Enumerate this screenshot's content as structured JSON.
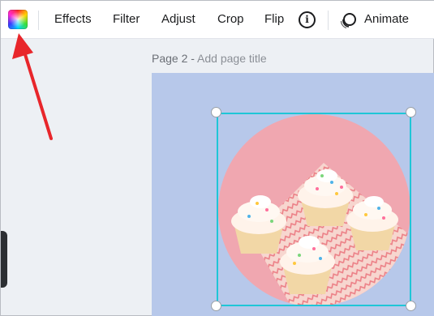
{
  "toolbar": {
    "effects_label": "Effects",
    "filter_label": "Filter",
    "adjust_label": "Adjust",
    "crop_label": "Crop",
    "flip_label": "Flip",
    "info_glyph": "i",
    "animate_label": "Animate"
  },
  "page": {
    "title_prefix": "Page 2 - ",
    "title_placeholder": "Add page title"
  },
  "colors": {
    "canvas_background": "#b7c8ea",
    "selection_border": "#1fc6d7",
    "annotation_arrow": "#e8262b",
    "photo_background": "#f0a9b2"
  },
  "icons": {
    "color_picker": "color-wheel-icon",
    "info": "info-icon",
    "animate": "animate-icon"
  }
}
